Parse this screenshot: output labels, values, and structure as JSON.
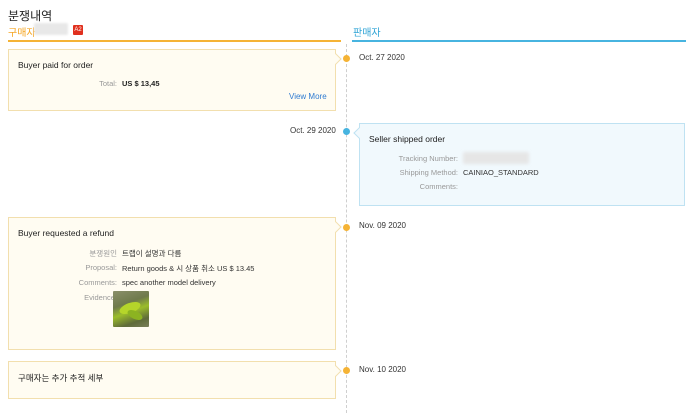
{
  "header": {
    "title": "분쟁내역",
    "buyer_label": "구매자",
    "badge": "A2",
    "seller_label": "판매자"
  },
  "events": [
    {
      "side": "buyer",
      "date": "Oct. 27 2020",
      "title": "Buyer paid for order",
      "total_label": "Total:",
      "total_value": "US $ 13,45",
      "link": "View More"
    },
    {
      "side": "seller",
      "date": "Oct. 29 2020",
      "title": "Seller shipped order",
      "tracking_label": "Tracking Number:",
      "shipping_label": "Shipping Method:",
      "shipping_value": "CAINIAO_STANDARD",
      "comments_label": "Comments:"
    },
    {
      "side": "buyer",
      "date": "Nov. 09 2020",
      "title": "Buyer requested a refund",
      "reason_label": "분쟁원인",
      "reason_value": "트랩이 설명과 다름",
      "proposal_label": "Proposal:",
      "proposal_value": "Return goods & 시 상품 취소 US $ 13.45",
      "comments_label": "Comments:",
      "comments_value": "spec another model delivery",
      "evidence_label": "Evidence:",
      "evidence_icon": "evidence-photo-icon"
    },
    {
      "side": "buyer",
      "date": "Nov. 10 2020",
      "title": "구매자는 추가 추적 세부"
    }
  ],
  "colors": {
    "buyer_accent": "#f5b335",
    "seller_accent": "#47b4e0",
    "link": "#2f7bd1",
    "badge": "#e0301e"
  }
}
